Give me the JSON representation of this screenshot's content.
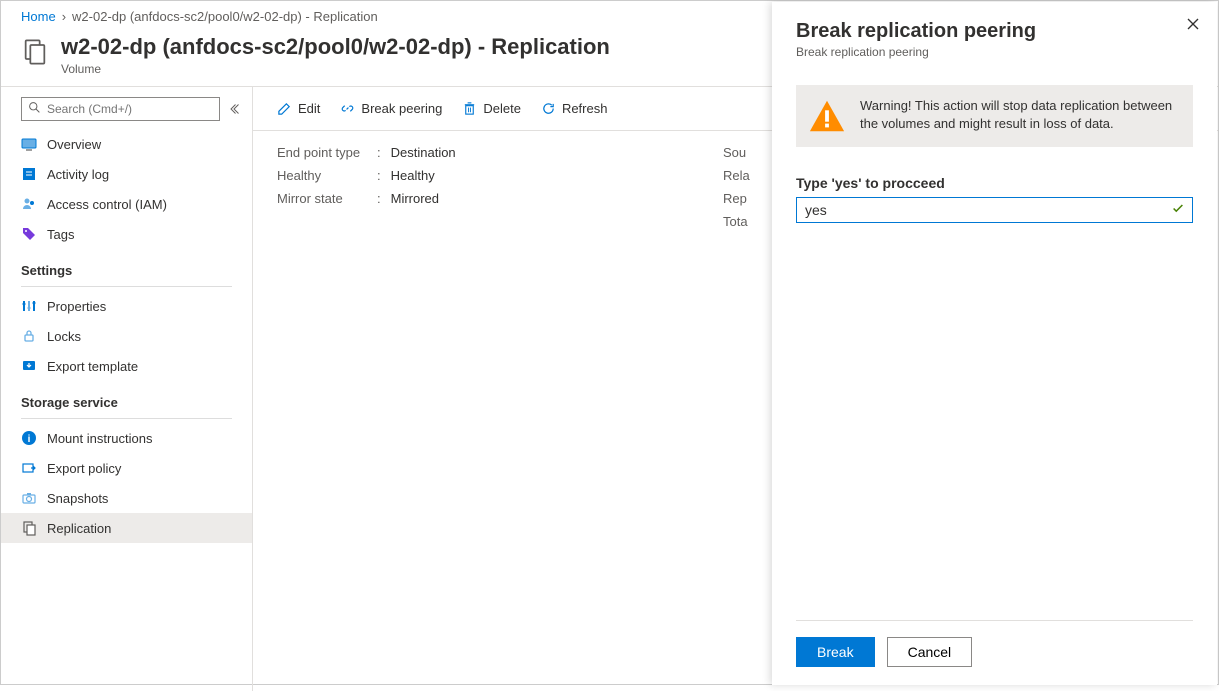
{
  "breadcrumb": {
    "home": "Home",
    "current": "w2-02-dp (anfdocs-sc2/pool0/w2-02-dp) - Replication"
  },
  "header": {
    "title": "w2-02-dp (anfdocs-sc2/pool0/w2-02-dp) - Replication",
    "subtitle": "Volume"
  },
  "sidebar": {
    "search_placeholder": "Search (Cmd+/)",
    "items": {
      "overview": "Overview",
      "activity_log": "Activity log",
      "access_control": "Access control (IAM)",
      "tags": "Tags"
    },
    "sections": {
      "settings": "Settings",
      "storage": "Storage service"
    },
    "settings_items": {
      "properties": "Properties",
      "locks": "Locks",
      "export_template": "Export template"
    },
    "storage_items": {
      "mount_instructions": "Mount instructions",
      "export_policy": "Export policy",
      "snapshots": "Snapshots",
      "replication": "Replication"
    }
  },
  "toolbar": {
    "edit": "Edit",
    "break_peering": "Break peering",
    "delete": "Delete",
    "refresh": "Refresh"
  },
  "properties": {
    "endpoint_label": "End point type",
    "endpoint_value": "Destination",
    "healthy_label": "Healthy",
    "healthy_value": "Healthy",
    "mirror_label": "Mirror state",
    "mirror_value": "Mirrored",
    "right": {
      "sou": "Sou",
      "rela": "Rela",
      "rep": "Rep",
      "tota": "Tota"
    }
  },
  "panel": {
    "title": "Break replication peering",
    "subtitle": "Break replication peering",
    "warning_text": "Warning! This action will stop data replication between the volumes and might result in loss of data.",
    "confirm_label": "Type 'yes' to procceed",
    "confirm_value": "yes",
    "break_btn": "Break",
    "cancel_btn": "Cancel"
  }
}
